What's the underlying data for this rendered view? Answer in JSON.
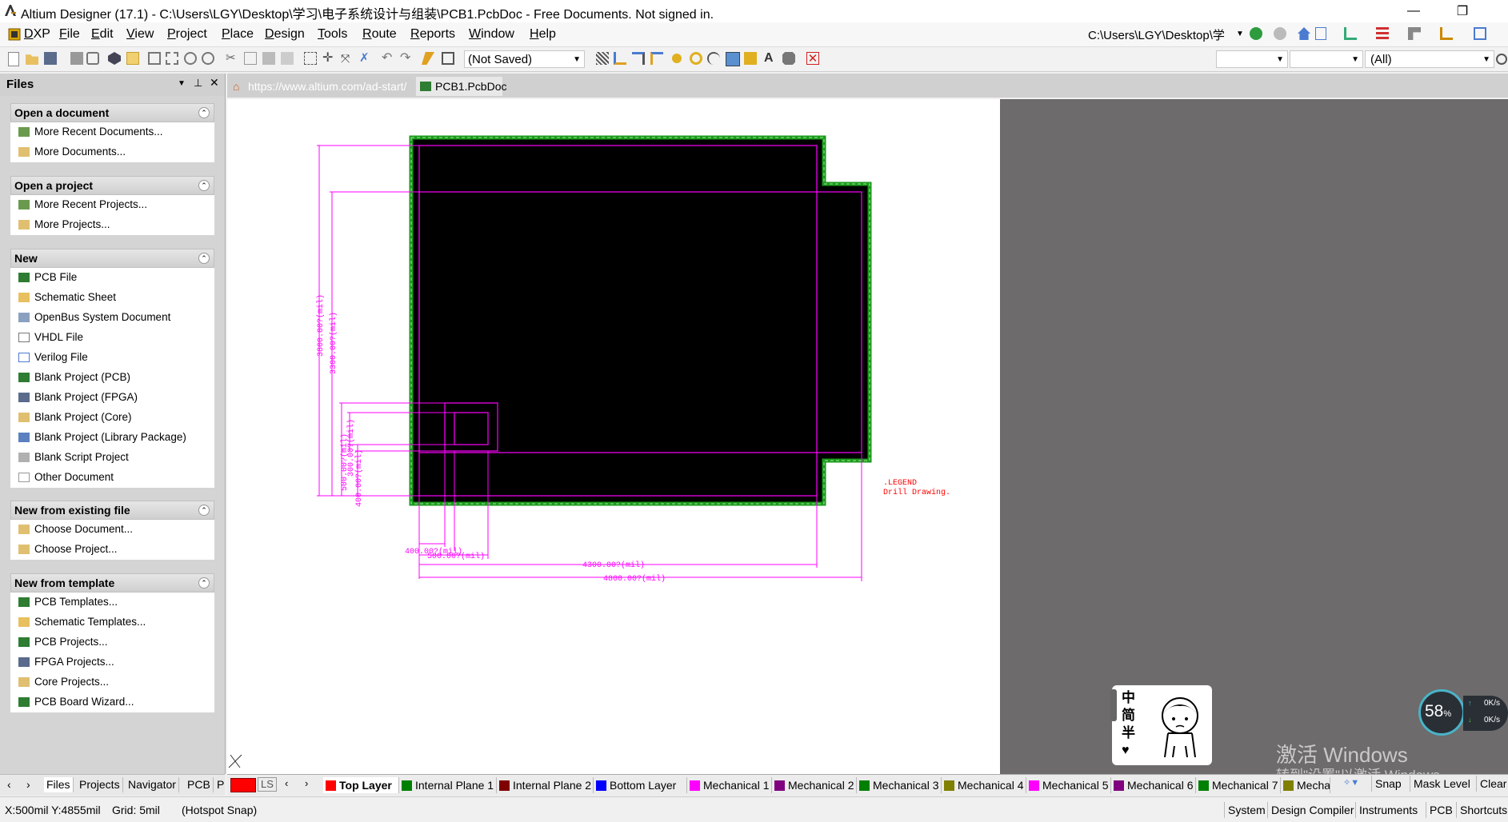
{
  "window": {
    "title": "Altium Designer (17.1) - C:\\Users\\LGY\\Desktop\\学习\\电子系统设计与组装\\PCB1.PcbDoc - Free Documents. Not signed in.",
    "minimize": "—",
    "restore": "❐"
  },
  "menu": [
    "DXP",
    "File",
    "Edit",
    "View",
    "Project",
    "Place",
    "Design",
    "Tools",
    "Route",
    "Reports",
    "Window",
    "Help"
  ],
  "path_box": "C:\\Users\\LGY\\Desktop\\学",
  "toolbar": {
    "variant_combo": "(Not Saved)",
    "filter_combo": "(All)"
  },
  "files_panel": {
    "title": "Files",
    "sections": [
      {
        "title": "Open a document",
        "items": [
          "More Recent Documents...",
          "More Documents..."
        ]
      },
      {
        "title": "Open a project",
        "items": [
          "More Recent Projects...",
          "More Projects..."
        ]
      },
      {
        "title": "New",
        "items": [
          "PCB File",
          "Schematic Sheet",
          "OpenBus System Document",
          "VHDL File",
          "Verilog File",
          "Blank Project (PCB)",
          "Blank Project (FPGA)",
          "Blank Project (Core)",
          "Blank Project (Library Package)",
          "Blank Script Project",
          "Other Document"
        ]
      },
      {
        "title": "New from existing file",
        "items": [
          "Choose Document...",
          "Choose Project..."
        ]
      },
      {
        "title": "New from template",
        "items": [
          "PCB Templates...",
          "Schematic Templates...",
          "PCB Projects...",
          "FPGA Projects...",
          "Core Projects...",
          "PCB Board Wizard..."
        ]
      }
    ],
    "tabs": [
      "Files",
      "Projects",
      "Navigator",
      "PCB",
      "P"
    ]
  },
  "doc_tabs": [
    "https://www.altium.com/ad-start/",
    "PCB1.PcbDoc"
  ],
  "board": {
    "dim_left_outer": "3800.00?(mil)",
    "dim_left_inner": "3300.00?(mil)",
    "dim_small_1": "500.00?(mil)",
    "dim_small_2": "300.00?(mil)",
    "dim_small_3": "400.00?(mil)",
    "dim_bottom_400": "400.00?(mil)",
    "dim_bottom_500": "500.00?(mil)",
    "dim_bottom_4300": "4300.00?(mil)",
    "dim_bottom_4800": "4800.00?(mil)",
    "legend_1": ".LEGEND",
    "legend_2": "Drill Drawing."
  },
  "layer_tabs": [
    {
      "label": "Top Layer",
      "color": "#ff0000",
      "active": true
    },
    {
      "label": "Internal Plane 1",
      "color": "#008000"
    },
    {
      "label": "Internal Plane 2",
      "color": "#800000"
    },
    {
      "label": "Bottom Layer",
      "color": "#0000ff"
    },
    {
      "label": "Mechanical 1",
      "color": "#ff00ff"
    },
    {
      "label": "Mechanical 2",
      "color": "#800080"
    },
    {
      "label": "Mechanical 3",
      "color": "#008000"
    },
    {
      "label": "Mechanical 4",
      "color": "#808000"
    },
    {
      "label": "Mechanical 5",
      "color": "#ff00ff"
    },
    {
      "label": "Mechanical 6",
      "color": "#800080"
    },
    {
      "label": "Mechanical 7",
      "color": "#008000"
    },
    {
      "label": "Mecha",
      "color": "#808000"
    }
  ],
  "layer_bar_right": [
    "Snap",
    "Mask Level",
    "Clear"
  ],
  "layer_set_label": "LS",
  "status": {
    "coords": "X:500mil Y:4855mil",
    "grid": "Grid: 5mil",
    "snap": "(Hotspot Snap)",
    "buttons": [
      "System",
      "Design Compiler",
      "Instruments",
      "PCB",
      "Shortcuts"
    ]
  },
  "overlay": {
    "speed_percent": "58",
    "speed_unit": "%",
    "up": "0K/s",
    "down": "0K/s",
    "ime_chars": [
      "中",
      "简",
      "半"
    ],
    "watermark_1": "激活 Windows",
    "watermark_2": "转到\"设置\"以激活 Windows。"
  }
}
